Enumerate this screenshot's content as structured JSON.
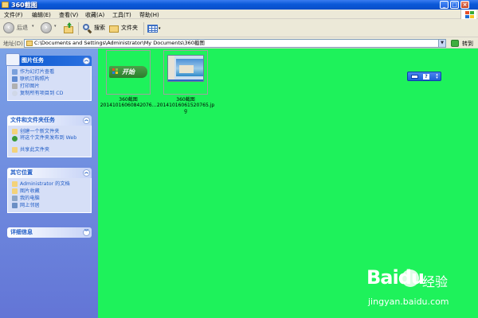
{
  "window": {
    "title": "360截图",
    "buttons": [
      "minimize",
      "maximize",
      "close"
    ]
  },
  "menu": {
    "items": [
      "文件(F)",
      "编辑(E)",
      "查看(V)",
      "收藏(A)",
      "工具(T)",
      "帮助(H)"
    ]
  },
  "toolbar": {
    "back_label": "后退",
    "search_label": "搜索",
    "folders_label": "文件夹",
    "icons": [
      "back-arrow-icon",
      "forward-arrow-icon",
      "up-folder-icon",
      "search-icon",
      "folders-icon",
      "views-icon"
    ]
  },
  "address": {
    "label": "地址(D)",
    "value": "C:\\Documents and Settings\\Administrator\\My Documents\\360截图",
    "go_label": "转到"
  },
  "sidebar": {
    "panels": [
      {
        "title": "图片任务",
        "tasks": [
          "作为幻灯片查看",
          "联机订购照片",
          "打印图片",
          "复制所有项目到 CD"
        ]
      },
      {
        "title": "文件和文件夹任务",
        "tasks": [
          "创建一个新文件夹",
          "将这个文件夹发布到 Web",
          "共享此文件夹"
        ]
      },
      {
        "title": "其它位置",
        "tasks": [
          "Administrator 的文档",
          "图片收藏",
          "我的电脑",
          "网上邻居"
        ]
      },
      {
        "title": "详细信息",
        "tasks": []
      }
    ]
  },
  "files": [
    {
      "name_line1": "360截图",
      "name_line2": "20141016060842076...",
      "thumb_text": "开始"
    },
    {
      "name_line1": "360截图",
      "name_line2": "20141016061520765.jp",
      "name_line3": "g"
    }
  ],
  "watermark": {
    "brand": "Baidu",
    "brand_cn": "经验",
    "url": "jingyan.baidu.com"
  },
  "colors": {
    "content_bg": "#1ef25b",
    "titlebar": "#0a58d8",
    "sidebar": "#6f8be0",
    "link": "#215dc6"
  }
}
